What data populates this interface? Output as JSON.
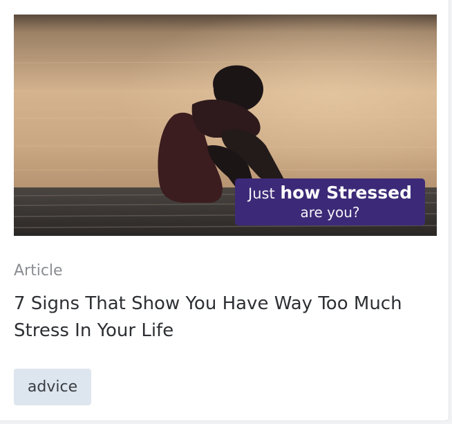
{
  "card": {
    "image": {
      "overlay_prefix": "Just",
      "overlay_bold": "how Stressed",
      "overlay_line2": "are you?",
      "colors": {
        "overlay_bg": "#3c2a78",
        "sky": "#c9a983",
        "dock": "#3b3734"
      }
    },
    "kicker": "Article",
    "title": "7 Signs That Show You Have Way Too Much Stress In Your Life",
    "tag": "advice"
  }
}
